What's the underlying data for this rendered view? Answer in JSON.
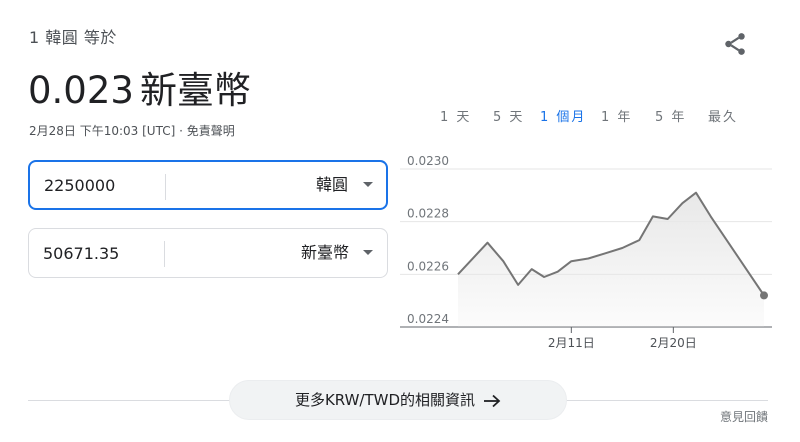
{
  "header": {
    "subtitle": "1 韓圓 等於",
    "rate_value": "0.023",
    "rate_unit": "新臺幣",
    "timestamp": "2月28日 下午10:03 [UTC] · 免責聲明"
  },
  "icons": {
    "share": "share-icon",
    "dropdown": "chevron-down-icon",
    "arrow": "arrow-right-icon"
  },
  "range_tabs": [
    {
      "label": "1 天",
      "active": false
    },
    {
      "label": "5 天",
      "active": false
    },
    {
      "label": "1 個月",
      "active": true
    },
    {
      "label": "1 年",
      "active": false
    },
    {
      "label": "5 年",
      "active": false
    },
    {
      "label": "最久",
      "active": false
    }
  ],
  "converter": {
    "from": {
      "amount": "2250000",
      "currency": "韓圓"
    },
    "to": {
      "amount": "50671.35",
      "currency": "新臺幣"
    }
  },
  "colors": {
    "accent": "#1a73e8",
    "line": "#757575",
    "area": "#e8e8e8"
  },
  "chart_data": {
    "type": "area",
    "y_ticks": [
      "0.0230",
      "0.0228",
      "0.0226",
      "0.0224"
    ],
    "ylim": [
      0.0224,
      0.023
    ],
    "x_tick_labels": [
      {
        "label": "2月11日",
        "day": 11
      },
      {
        "label": "2月20日",
        "day": 20
      }
    ],
    "xlim": [
      1,
      28
    ],
    "points": [
      {
        "day": 1,
        "value": 0.0226
      },
      {
        "day": 3.6,
        "value": 0.02272
      },
      {
        "day": 5.0,
        "value": 0.02265
      },
      {
        "day": 6.3,
        "value": 0.02256
      },
      {
        "day": 7.5,
        "value": 0.02262
      },
      {
        "day": 8.6,
        "value": 0.02259
      },
      {
        "day": 9.8,
        "value": 0.02261
      },
      {
        "day": 11.0,
        "value": 0.02265
      },
      {
        "day": 12.5,
        "value": 0.02266
      },
      {
        "day": 14.0,
        "value": 0.02268
      },
      {
        "day": 15.5,
        "value": 0.0227
      },
      {
        "day": 17.0,
        "value": 0.02273
      },
      {
        "day": 18.2,
        "value": 0.02282
      },
      {
        "day": 19.5,
        "value": 0.02281
      },
      {
        "day": 20.8,
        "value": 0.02287
      },
      {
        "day": 22.0,
        "value": 0.02291
      },
      {
        "day": 23.3,
        "value": 0.02282
      },
      {
        "day": 28.0,
        "value": 0.02252
      }
    ],
    "grid": true
  },
  "footer": {
    "more_label": "更多KRW/TWD的相關資訊",
    "feedback_label": "意見回饋"
  }
}
